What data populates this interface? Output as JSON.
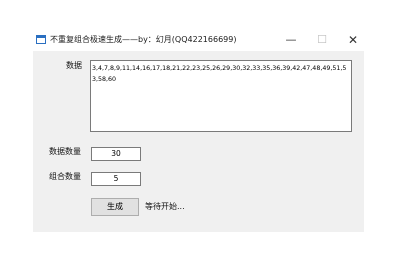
{
  "window": {
    "title": "不重复组合极速生成——by：幻月(QQ422166699)",
    "controls": {
      "minimize": "—",
      "maximize": "☐",
      "close": "✕"
    }
  },
  "form": {
    "data_label": "数据",
    "data_value": "3,4,7,8,9,11,14,16,17,18,21,22,23,25,26,29,30,32,33,35,36,39,42,47,48,49,51,53,58,60",
    "count_label": "数据数量",
    "count_value": "30",
    "combo_label": "组合数量",
    "combo_value": "5",
    "generate_button": "生成",
    "status_text": "等待开始..."
  }
}
